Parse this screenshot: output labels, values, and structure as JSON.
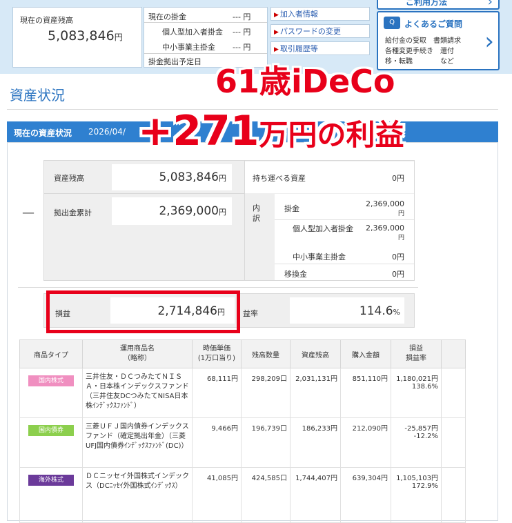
{
  "summary": {
    "balance_label": "現在の資産残高",
    "balance_value": "5,083,846",
    "yen": "円",
    "contrib_label": "現在の掛金",
    "contrib_value": "--- 円",
    "personal_label": "個人型加入者掛金",
    "personal_value": "--- 円",
    "employer_label": "中小事業主掛金",
    "employer_value": "--- 円",
    "schedule_label": "掛金拠出予定日"
  },
  "links": [
    "加入者情報",
    "パスワードの変更",
    "取引履歴等"
  ],
  "faq": {
    "top_text": "ご利用方法",
    "title": "よくあるご質問",
    "line1": "給付金の受取　書類請求",
    "line2": "各種変更手続き　還付",
    "line3": "移・転職　　　　など"
  },
  "section_title": "資産状況",
  "bar_title": "現在の資産状況",
  "bar_date": "2026/04/",
  "assets": {
    "dash": "—",
    "balance_label": "資産残高",
    "balance_value": "5,083,846",
    "contrib_label": "拠出金累計",
    "contrib_value": "2,369,000",
    "yen": "円",
    "portable_label": "持ち運べる資産",
    "portable_value": "0円",
    "breakdown_label": "内訳",
    "kakekin_label": "掛金",
    "kakekin_value": "2,369,000",
    "personal_label": "個人型加入者掛金",
    "personal_value": "2,369,000",
    "employer_label": "中小事業主掛金",
    "employer_value": "0円",
    "transfer_label": "移換金",
    "transfer_value": "0円",
    "pl_label": "損益",
    "pl_value": "2,714,846",
    "rate_label": "益率",
    "rate_value": "114.6",
    "pct": "%"
  },
  "table": {
    "headers": [
      "商品タイプ",
      "運用商品名\n（略称）",
      "時価単価\n(1万口当り)",
      "残高数量",
      "資産残高",
      "購入金額",
      "損益\n損益率"
    ],
    "rows": [
      {
        "type": "国内株式",
        "type_color": "#f08fc0",
        "name": "三井住友・ＤＣつみたてＮＩＳＡ・日本株インデックスファンド（三井住友DCつみたてNISA日本株ｲﾝﾃﾞｯｸｽﾌｧﾝﾄﾞ）",
        "price": "68,111円",
        "qty": "298,209口",
        "balance": "2,031,131円",
        "cost": "851,110円",
        "pl": "1,180,021円",
        "rate": "138.6%",
        "negative": false
      },
      {
        "type": "国内債券",
        "type_color": "#8ccf4d",
        "name": "三菱ＵＦＪ国内債券インデックスファンド（確定拠出年金）（三菱UFJ国内債券ｲﾝﾃﾞｯｸｽﾌｧﾝﾄﾞ(DC)）",
        "price": "9,466円",
        "qty": "196,739口",
        "balance": "186,233円",
        "cost": "212,090円",
        "pl": "-25,857円",
        "rate": "-12.2%",
        "negative": true
      },
      {
        "type": "海外株式",
        "type_color": "#6b3a9a",
        "name": "ＤＣニッセイ外国株式インデックス（DCﾆｯｾｲ外国株式ｲﾝﾃﾞｯｸｽ）",
        "price": "41,085円",
        "qty": "424,585口",
        "balance": "1,744,407円",
        "cost": "639,304円",
        "pl": "1,105,103円",
        "rate": "172.9%",
        "negative": false
      }
    ]
  },
  "overlay": {
    "line1": "61歳iDeCo",
    "line2_big": "+271",
    "line2_small": "万円の利益"
  }
}
